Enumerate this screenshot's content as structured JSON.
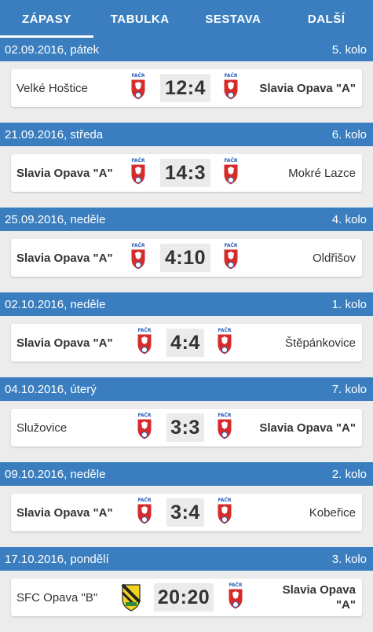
{
  "tabs": [
    {
      "label": "ZÁPASY"
    },
    {
      "label": "TABULKA"
    },
    {
      "label": "SESTAVA"
    },
    {
      "label": "DALŠÍ"
    }
  ],
  "matches": [
    {
      "date": "02.09.2016, pátek",
      "round": "5. kolo",
      "home": "Velké Hoštice",
      "away": "Slavia Opava \"A\"",
      "score": "12:4",
      "home_crest": "facr-crest-icon",
      "away_crest": "facr-crest-icon"
    },
    {
      "date": "21.09.2016, středa",
      "round": "6. kolo",
      "home": "Slavia Opava \"A\"",
      "away": "Mokré Lazce",
      "score": "14:3",
      "home_crest": "facr-crest-icon",
      "away_crest": "facr-crest-icon"
    },
    {
      "date": "25.09.2016, neděle",
      "round": "4. kolo",
      "home": "Slavia Opava \"A\"",
      "away": "Oldřišov",
      "score": "4:10",
      "home_crest": "facr-crest-icon",
      "away_crest": "facr-crest-icon"
    },
    {
      "date": "02.10.2016, neděle",
      "round": "1. kolo",
      "home": "Slavia Opava \"A\"",
      "away": "Štěpánkovice",
      "score": "4:4",
      "home_crest": "facr-crest-icon",
      "away_crest": "facr-crest-icon"
    },
    {
      "date": "04.10.2016, úterý",
      "round": "7. kolo",
      "home": "Služovice",
      "away": "Slavia Opava \"A\"",
      "score": "3:3",
      "home_crest": "facr-crest-icon",
      "away_crest": "facr-crest-icon"
    },
    {
      "date": "09.10.2016, neděle",
      "round": "2. kolo",
      "home": "Slavia Opava \"A\"",
      "away": "Kobeřice",
      "score": "3:4",
      "home_crest": "facr-crest-icon",
      "away_crest": "facr-crest-icon"
    },
    {
      "date": "17.10.2016, pondělí",
      "round": "3. kolo",
      "home": "SFC Opava \"B\"",
      "away_line1": "Slavia Opava",
      "away_line2": "\"A\"",
      "score": "20:20",
      "home_crest": "sfc-opava-crest-icon",
      "away_crest": "facr-crest-icon"
    }
  ],
  "colors": {
    "primary": "#3a7ebf",
    "background": "#ececec",
    "card": "#ffffff",
    "score_bg": "#ebebeb",
    "crest_red": "#d52b2b",
    "crest_blue": "#2a5fb8",
    "sfc_yellow": "#f2d21c"
  }
}
